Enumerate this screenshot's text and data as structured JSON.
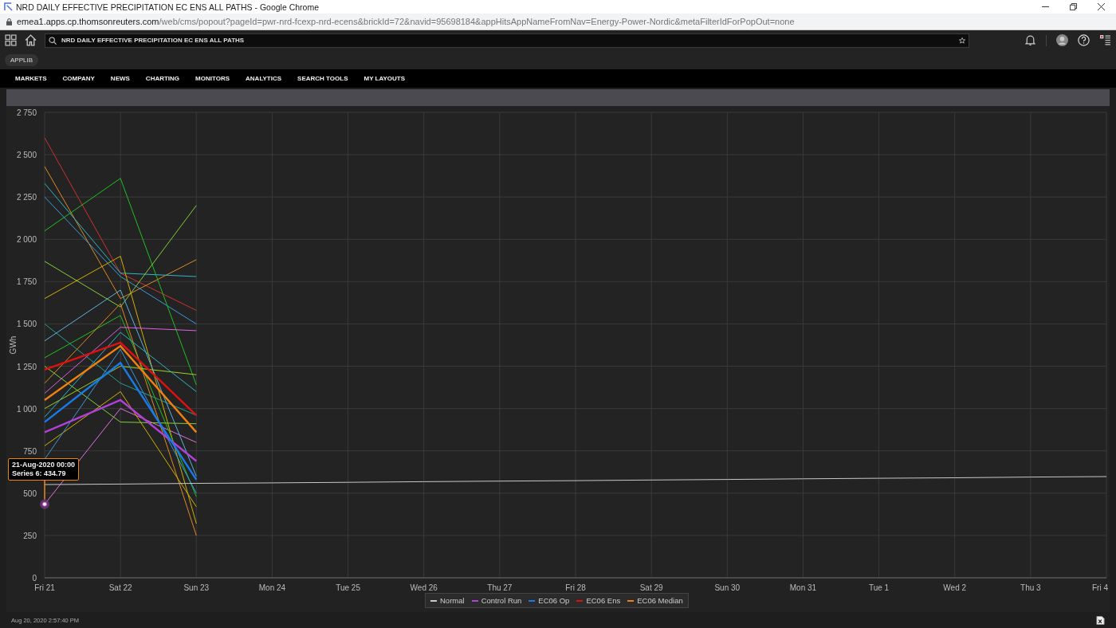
{
  "browser": {
    "title": "NRD DAILY EFFECTIVE PRECIPITATION EC ENS ALL PATHS - Google Chrome",
    "url_host": "emea1.apps.cp.thomsonreuters.com",
    "url_path": "/web/cms/popout?pageId=pwr-nrd-fcexp-nrd-ecens&brickId=72&navid=95698184&appHitsAppNameFromNav=Energy-Power-Nordic&metaFilterIdForPopOut=none"
  },
  "app_bar": {
    "search_value": "NRD DAILY EFFECTIVE PRECIPITATION EC ENS ALL PATHS"
  },
  "applib": "APPLIB",
  "nav": [
    "MARKETS",
    "COMPANY",
    "NEWS",
    "CHARTING",
    "MONITORS",
    "ANALYTICS",
    "SEARCH TOOLS",
    "MY LAYOUTS"
  ],
  "chart": {
    "chart_data": {
      "type": "line",
      "ylabel": "GWh",
      "categories": [
        "Fri 21",
        "Sat 22",
        "Sun 23",
        "Mon 24",
        "Tue 25",
        "Wed 26",
        "Thu 27",
        "Fri 28",
        "Sat 29",
        "Sun 30",
        "Mon 31",
        "Tue 1",
        "Wed 2",
        "Thu 3",
        "Fri 4"
      ],
      "ylim": [
        0,
        2750
      ],
      "yticks": [
        0,
        250,
        500,
        750,
        {
          "value": 1000,
          "label": "1 000"
        },
        {
          "value": 1250,
          "label": "1 250"
        },
        {
          "value": 1500,
          "label": "1 500"
        },
        {
          "value": 1750,
          "label": "1 750"
        },
        {
          "value": 2000,
          "label": "2 000"
        },
        {
          "value": 2250,
          "label": "2 250"
        },
        {
          "value": 2500,
          "label": "2 500"
        },
        {
          "value": 2750,
          "label": "2 750"
        }
      ],
      "series": [
        {
          "name": "Normal",
          "color": "#c8c8c8",
          "values": [
            551,
            554,
            558,
            561,
            564,
            568,
            571,
            574,
            578,
            581,
            585,
            588,
            591,
            595,
            598
          ]
        },
        {
          "name": "Control Run",
          "color": "#b040d8",
          "values": [
            860,
            1050,
            690,
            null,
            null,
            null,
            null,
            null,
            null,
            null,
            null,
            null,
            null,
            null,
            null
          ]
        },
        {
          "name": "EC06 Op",
          "color": "#1a7ae8",
          "values": [
            920,
            1270,
            580,
            null,
            null,
            null,
            null,
            null,
            null,
            null,
            null,
            null,
            null,
            null,
            null
          ]
        },
        {
          "name": "EC06 Ens",
          "color": "#e01010",
          "values": [
            1230,
            1390,
            960,
            null,
            null,
            null,
            null,
            null,
            null,
            null,
            null,
            null,
            null,
            null,
            null
          ]
        },
        {
          "name": "EC06 Median",
          "color": "#f08010",
          "values": [
            1050,
            1370,
            860,
            null,
            null,
            null,
            null,
            null,
            null,
            null,
            null,
            null,
            null,
            null,
            null
          ]
        },
        {
          "color": "#d03030",
          "values": [
            2600,
            1800,
            1580,
            null,
            null,
            null,
            null,
            null,
            null,
            null,
            null,
            null,
            null,
            null,
            null
          ]
        },
        {
          "color": "#e08a20",
          "values": [
            2430,
            1650,
            1880,
            null,
            null,
            null,
            null,
            null,
            null,
            null,
            null,
            null,
            null,
            null,
            null
          ]
        },
        {
          "color": "#2fb5c8",
          "values": [
            2330,
            1800,
            1780,
            null,
            null,
            null,
            null,
            null,
            null,
            null,
            null,
            null,
            null,
            null,
            null
          ]
        },
        {
          "color": "#3a9ad9",
          "values": [
            2250,
            1780,
            1500,
            null,
            null,
            null,
            null,
            null,
            null,
            null,
            null,
            null,
            null,
            null,
            null
          ]
        },
        {
          "color": "#22c022",
          "values": [
            2050,
            2360,
            1140,
            null,
            null,
            null,
            null,
            null,
            null,
            null,
            null,
            null,
            null,
            null,
            null
          ]
        },
        {
          "color": "#e070e0",
          "values": [
            434.79,
            1000,
            800,
            null,
            null,
            null,
            null,
            null,
            null,
            null,
            null,
            null,
            null,
            null,
            null
          ]
        },
        {
          "color": "#7fd13b",
          "values": [
            1870,
            1600,
            2200,
            null,
            null,
            null,
            null,
            null,
            null,
            null,
            null,
            null,
            null,
            null,
            null
          ]
        },
        {
          "color": "#d4b000",
          "values": [
            1650,
            1900,
            320,
            null,
            null,
            null,
            null,
            null,
            null,
            null,
            null,
            null,
            null,
            null,
            null
          ]
        },
        {
          "color": "#20a090",
          "values": [
            1500,
            1150,
            960,
            null,
            null,
            null,
            null,
            null,
            null,
            null,
            null,
            null,
            null,
            null,
            null
          ]
        },
        {
          "color": "#5ab4e0",
          "values": [
            1400,
            1700,
            600,
            null,
            null,
            null,
            null,
            null,
            null,
            null,
            null,
            null,
            null,
            null,
            null
          ]
        },
        {
          "color": "#22c022",
          "values": [
            1300,
            1550,
            480,
            null,
            null,
            null,
            null,
            null,
            null,
            null,
            null,
            null,
            null,
            null,
            null
          ]
        },
        {
          "color": "#e08a20",
          "values": [
            1150,
            1620,
            250,
            null,
            null,
            null,
            null,
            null,
            null,
            null,
            null,
            null,
            null,
            null,
            null
          ]
        },
        {
          "color": "#a0d020",
          "values": [
            1000,
            1250,
            1200,
            null,
            null,
            null,
            null,
            null,
            null,
            null,
            null,
            null,
            null,
            null,
            null
          ]
        },
        {
          "color": "#d4b000",
          "values": [
            780,
            1100,
            420,
            null,
            null,
            null,
            null,
            null,
            null,
            null,
            null,
            null,
            null,
            null,
            null
          ]
        },
        {
          "color": "#2fb5c8",
          "values": [
            950,
            1450,
            1100,
            null,
            null,
            null,
            null,
            null,
            null,
            null,
            null,
            null,
            null,
            null,
            null
          ]
        },
        {
          "color": "#7fd13b",
          "values": [
            1250,
            920,
            910,
            null,
            null,
            null,
            null,
            null,
            null,
            null,
            null,
            null,
            null,
            null,
            null
          ]
        },
        {
          "color": "#3a9ad9",
          "values": [
            700,
            1350,
            500,
            null,
            null,
            null,
            null,
            null,
            null,
            null,
            null,
            null,
            null,
            null,
            null
          ]
        },
        {
          "color": "#e060e0",
          "values": [
            1090,
            1480,
            1460,
            null,
            null,
            null,
            null,
            null,
            null,
            null,
            null,
            null,
            null,
            null,
            null
          ]
        }
      ],
      "grid": true,
      "legend": true,
      "annotations": [
        {
          "x": "Fri 21",
          "y": 434.79,
          "text": "Series 6: 434.79"
        }
      ]
    },
    "tooltip": {
      "date": "21-Aug-2020 00:00"
    }
  },
  "footer": {
    "timestamp": "Aug 20, 2020 2:57:40 PM"
  }
}
